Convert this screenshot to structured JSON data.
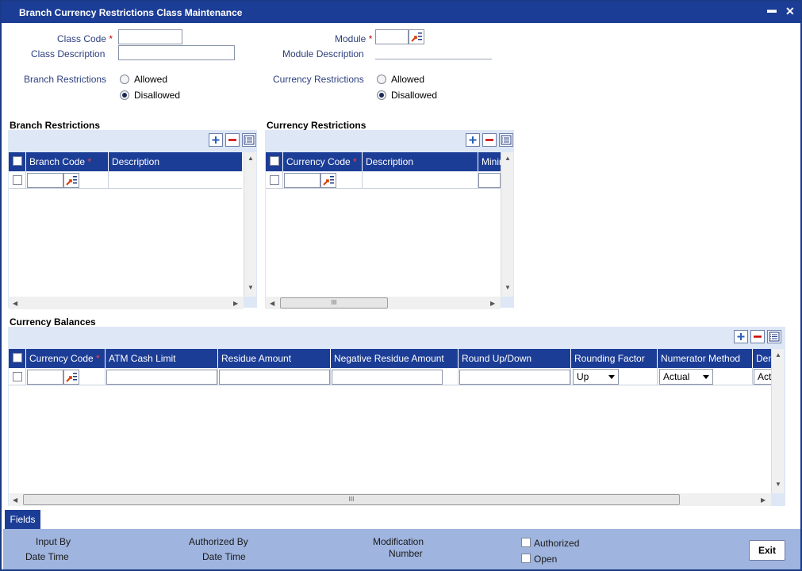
{
  "window": {
    "title": "Branch Currency Restrictions Class Maintenance",
    "minimize": "▬",
    "close": "✕"
  },
  "form": {
    "class_code_label": "Class Code",
    "class_description_label": "Class Description",
    "module_label": "Module",
    "module_description_label": "Module Description",
    "required_mark": "*",
    "class_code_value": "",
    "class_description_value": "",
    "module_value": "",
    "branch_restrictions_label": "Branch Restrictions",
    "currency_restrictions_label": "Currency Restrictions",
    "allowed_label": "Allowed",
    "disallowed_label": "Disallowed",
    "branch_restriction_selected": "Disallowed",
    "currency_restriction_selected": "Disallowed"
  },
  "branch_grid": {
    "section_title": "Branch Restrictions",
    "columns": [
      "Branch Code",
      "Description"
    ]
  },
  "currency_grid": {
    "section_title": "Currency Restrictions",
    "columns": [
      "Currency Code",
      "Description",
      "Minimum"
    ]
  },
  "balances_grid": {
    "section_title": "Currency Balances",
    "columns": [
      "Currency Code",
      "ATM Cash Limit",
      "Residue Amount",
      "Negative Residue Amount",
      "Round Up/Down",
      "Rounding Factor",
      "Numerator Method",
      "Denominator Method"
    ],
    "rounding_factor_value": "Up",
    "numerator_method_value": "Actual",
    "denominator_method_value": "Actual"
  },
  "scroll": {
    "vertical_thumb": "▬",
    "horizontal_thumb": "III",
    "up_arrow": "▲",
    "down_arrow": "▼",
    "left_arrow": "◀",
    "right_arrow": "▶"
  },
  "footer": {
    "fields_button": "Fields",
    "input_by": "Input By",
    "date_time": "Date Time",
    "authorized_by": "Authorized By",
    "modification": "Modification",
    "number": "Number",
    "authorized": "Authorized",
    "open": "Open",
    "exit_button": "Exit"
  },
  "colors": {
    "title_bar": "#1c3d96",
    "label_blue": "#2c3f7e",
    "required_red": "#c00000",
    "footer_bg": "#9fb4de",
    "grid_bar": "#dde7f6"
  }
}
